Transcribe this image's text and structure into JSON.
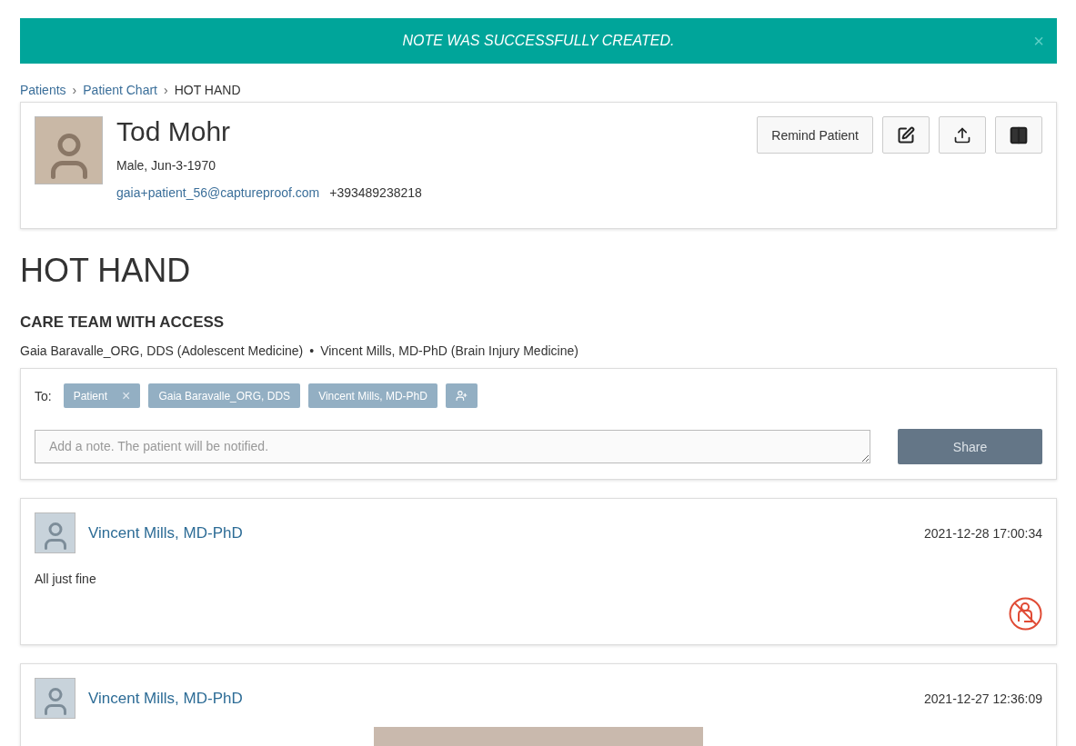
{
  "banner": {
    "message": "NOTE WAS SUCCESSFULLY CREATED.",
    "close": "×"
  },
  "breadcrumb": [
    "Patients",
    "Patient Chart",
    "HOT HAND"
  ],
  "breadcrumb_separator": "›",
  "patient": {
    "name": "Tod Mohr",
    "details": "Male, Jun-3-1970",
    "email": "gaia+patient_56@captureproof.com",
    "phone": "+393489238218",
    "remind_button": "Remind Patient"
  },
  "page_title": "HOT HAND",
  "care_team": {
    "heading": "CARE TEAM WITH ACCESS",
    "members": [
      "Gaia Baravalle_ORG, DDS (Adolescent Medicine)",
      "Vincent Mills, MD-PhD (Brain Injury Medicine)"
    ],
    "separator": "•"
  },
  "compose": {
    "to_label": "To:",
    "recipients": [
      {
        "label": "Patient",
        "removable": true
      },
      {
        "label": "Gaia Baravalle_ORG, DDS",
        "removable": false
      },
      {
        "label": "Vincent Mills, MD-PhD",
        "removable": false
      }
    ],
    "remove_mark": "×",
    "placeholder": "Add a note. The patient will be notified.",
    "share_button": "Share"
  },
  "notes": [
    {
      "author": "Vincent Mills, MD-PhD",
      "timestamp": "2021-12-28 17:00:34",
      "text": "All just fine",
      "has_photo": false,
      "hidden_from_patient": true
    },
    {
      "author": "Vincent Mills, MD-PhD",
      "timestamp": "2021-12-27 12:36:09",
      "has_photo": true,
      "hidden_from_patient": false
    }
  ]
}
